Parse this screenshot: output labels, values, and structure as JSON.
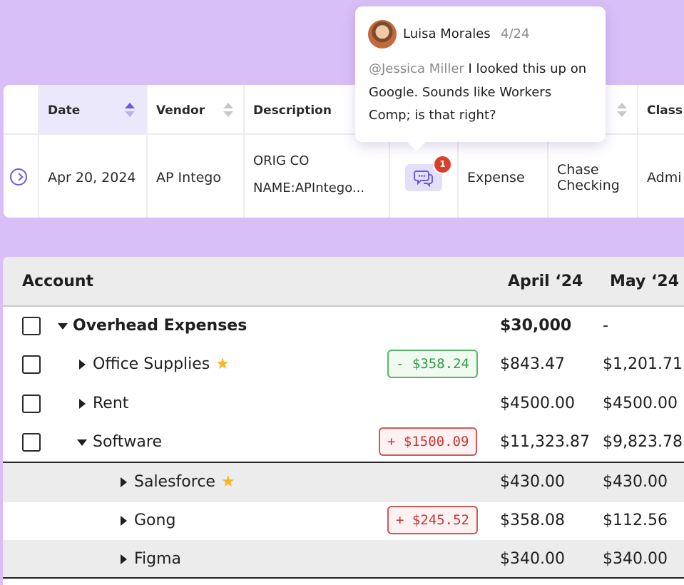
{
  "transactions": {
    "columns": [
      {
        "label": "Date",
        "sorted": "asc"
      },
      {
        "label": "Vendor"
      },
      {
        "label": "Description"
      },
      {
        "label": ""
      },
      {
        "label": ""
      },
      {
        "label": ""
      },
      {
        "label": "Class"
      }
    ],
    "row": {
      "date": "Apr 20, 2024",
      "vendor": "AP Intego",
      "description_line1": "ORIG CO",
      "description_line2": "NAME:APIntego...",
      "comment_count": "1",
      "type": "Expense",
      "account_line1": "Chase",
      "account_line2": "Checking",
      "class": "Admi"
    }
  },
  "comment": {
    "author": "Luisa Morales",
    "date": "4/24",
    "mention": "@Jessica Miller",
    "text": " I looked this up on Google. Sounds like Workers Comp; is that right?"
  },
  "accounts": {
    "headers": {
      "account": "Account",
      "col1": "April ‘24",
      "col2": "May ‘24"
    },
    "rows": [
      {
        "label": "Overhead Expenses",
        "v1": "$30,000",
        "v2": "-",
        "delta": ""
      },
      {
        "label": "Office Supplies",
        "v1": "$843.47",
        "v2": "$1,201.71",
        "delta": "- $358.24"
      },
      {
        "label": "Rent",
        "v1": "$4500.00",
        "v2": "$4500.00",
        "delta": ""
      },
      {
        "label": "Software",
        "v1": "$11,323.87",
        "v2": "$9,823.78",
        "delta": "+ $1500.09"
      },
      {
        "label": "Salesforce",
        "v1": "$430.00",
        "v2": "$430.00",
        "delta": ""
      },
      {
        "label": "Gong",
        "v1": "$358.08",
        "v2": "$112.56",
        "delta": "+ $245.52"
      },
      {
        "label": "Figma",
        "v1": "$340.00",
        "v2": "$340.00",
        "delta": ""
      }
    ]
  },
  "icons": {
    "expand": "chevron-right-circle-icon",
    "comment": "chat-bubbles-icon",
    "star": "star-icon",
    "collapse": "caret-down-icon",
    "expand_row": "caret-right-icon"
  },
  "colors": {
    "background": "#d8bff7",
    "accent": "#6b5ae0",
    "badge": "#d9402c",
    "positive": "#2e9a46",
    "negative": "#c23838",
    "star": "#f5b623"
  }
}
